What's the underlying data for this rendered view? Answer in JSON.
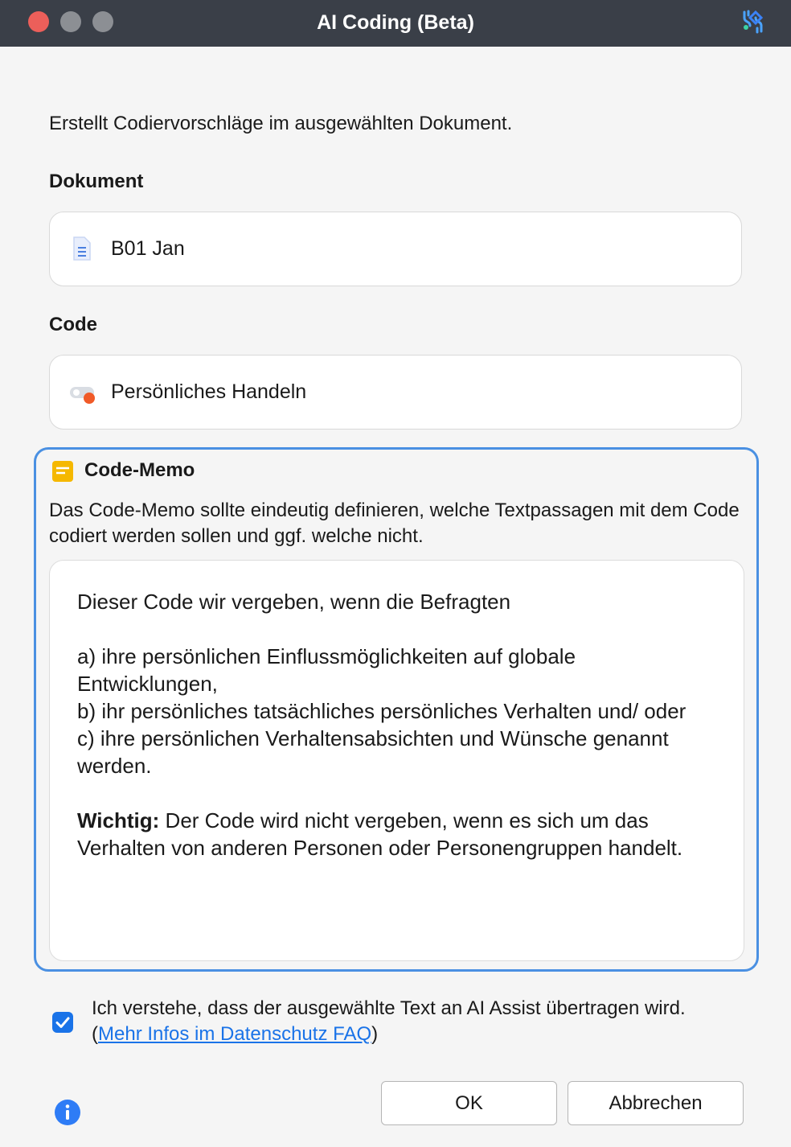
{
  "window": {
    "title": "AI Coding (Beta)",
    "buttons": [
      "close",
      "minimize",
      "maximize"
    ],
    "logo_icon": "ai-assist-logo-icon"
  },
  "intro": "Erstellt Codiervorschläge im ausgewählten Dokument.",
  "document": {
    "label": "Dokument",
    "value": "B01 Jan",
    "icon": "text-document-icon"
  },
  "code": {
    "label": "Code",
    "value": "Persönliches Handeln",
    "icon": "code-icon",
    "color": "#f05a28"
  },
  "memo": {
    "title": "Code-Memo",
    "icon": "memo-icon",
    "hint": "Das Code-Memo sollte eindeutig definieren, welche Textpassagen mit dem Code codiert werden sollen und ggf. welche nicht.",
    "lines": [
      "Dieser Code wir vergeben, wenn die Befragten",
      "a) ihre persönlichen Einflussmöglichkeiten auf globale Entwicklungen,",
      "b) ihr persönliches tatsächliches persönliches Verhalten und/ oder",
      "c) ihre persönlichen Verhaltensabsichten und Wünsche genannt werden."
    ],
    "important_label": "Wichtig:",
    "important_text": " Der Code wird nicht vergeben, wenn es sich um das Verhalten von anderen Personen oder Personengruppen handelt."
  },
  "consent": {
    "checked": true,
    "text": "Ich verstehe, dass der ausgewählte Text an AI Assist übertragen wird. (",
    "link": "Mehr Infos im Datenschutz FAQ",
    "suffix": ")"
  },
  "buttons": {
    "ok": "OK",
    "cancel": "Abbrechen"
  },
  "colors": {
    "accent": "#1a73e8",
    "focus_border": "#4a90e2",
    "titlebar": "#3a3f48",
    "memo_icon": "#f5b800"
  }
}
